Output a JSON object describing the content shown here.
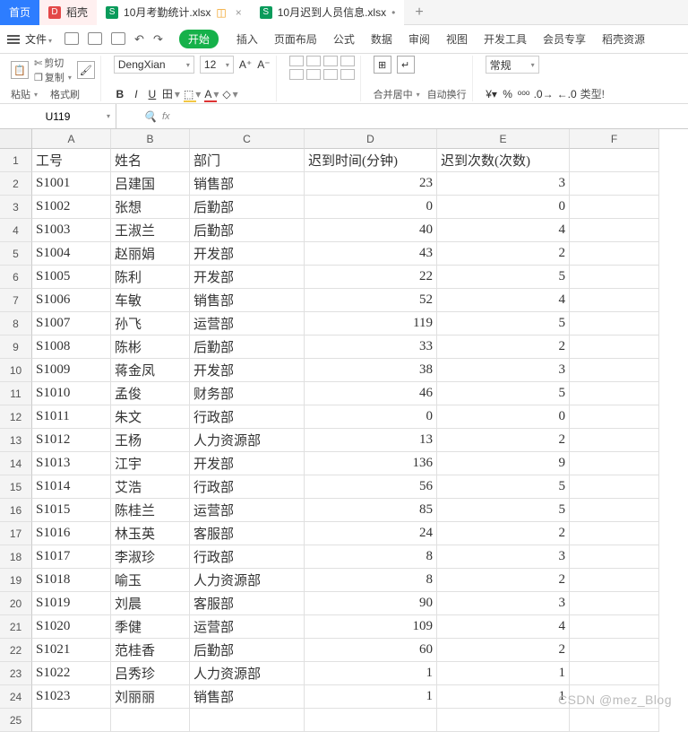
{
  "tabs": {
    "home": "首页",
    "dk": "稻壳",
    "file1": "10月考勤统计.xlsx",
    "file2": "10月迟到人员信息.xlsx",
    "file2_dot": "•"
  },
  "menu": {
    "file": "文件",
    "start": "开始",
    "insert": "插入",
    "layout": "页面布局",
    "formula": "公式",
    "data": "数据",
    "review": "审阅",
    "view": "视图",
    "dev": "开发工具",
    "member": "会员专享",
    "dkres": "稻壳资源"
  },
  "ribbon": {
    "cut": "剪切",
    "copy": "复制",
    "paste": "粘贴",
    "fmtpaint": "格式刷",
    "font": "DengXian",
    "size": "12",
    "bold": "B",
    "italic": "I",
    "under": "U",
    "merge": "合并居中",
    "wrap": "自动换行",
    "general": "常规",
    "typemenu": "类型!"
  },
  "namebox": "U119",
  "fx": "fx",
  "columns": [
    "A",
    "B",
    "C",
    "D",
    "E",
    "F"
  ],
  "widths": [
    "wA",
    "wB",
    "wC",
    "wD",
    "wE",
    "wF"
  ],
  "headers": [
    "工号",
    "姓名",
    "部门",
    "迟到时间(分钟)",
    "迟到次数(次数)",
    ""
  ],
  "rows": [
    [
      "S1001",
      "吕建国",
      "销售部",
      "23",
      "3",
      ""
    ],
    [
      "S1002",
      "张想",
      "后勤部",
      "0",
      "0",
      ""
    ],
    [
      "S1003",
      "王淑兰",
      "后勤部",
      "40",
      "4",
      ""
    ],
    [
      "S1004",
      "赵丽娟",
      "开发部",
      "43",
      "2",
      ""
    ],
    [
      "S1005",
      "陈利",
      "开发部",
      "22",
      "5",
      ""
    ],
    [
      "S1006",
      "车敏",
      "销售部",
      "52",
      "4",
      ""
    ],
    [
      "S1007",
      "孙飞",
      "运营部",
      "119",
      "5",
      ""
    ],
    [
      "S1008",
      "陈彬",
      "后勤部",
      "33",
      "2",
      ""
    ],
    [
      "S1009",
      "蒋金凤",
      "开发部",
      "38",
      "3",
      ""
    ],
    [
      "S1010",
      "孟俊",
      "财务部",
      "46",
      "5",
      ""
    ],
    [
      "S1011",
      "朱文",
      "行政部",
      "0",
      "0",
      ""
    ],
    [
      "S1012",
      "王杨",
      "人力资源部",
      "13",
      "2",
      ""
    ],
    [
      "S1013",
      "江宇",
      "开发部",
      "136",
      "9",
      ""
    ],
    [
      "S1014",
      "艾浩",
      "行政部",
      "56",
      "5",
      ""
    ],
    [
      "S1015",
      "陈桂兰",
      "运营部",
      "85",
      "5",
      ""
    ],
    [
      "S1016",
      "林玉英",
      "客服部",
      "24",
      "2",
      ""
    ],
    [
      "S1017",
      "李淑珍",
      "行政部",
      "8",
      "3",
      ""
    ],
    [
      "S1018",
      "喻玉",
      "人力资源部",
      "8",
      "2",
      ""
    ],
    [
      "S1019",
      "刘晨",
      "客服部",
      "90",
      "3",
      ""
    ],
    [
      "S1020",
      "季健",
      "运营部",
      "109",
      "4",
      ""
    ],
    [
      "S1021",
      "范桂香",
      "后勤部",
      "60",
      "2",
      ""
    ],
    [
      "S1022",
      "吕秀珍",
      "人力资源部",
      "1",
      "1",
      ""
    ],
    [
      "S1023",
      "刘丽丽",
      "销售部",
      "1",
      "1",
      ""
    ]
  ],
  "watermark": "CSDN @mez_Blog"
}
